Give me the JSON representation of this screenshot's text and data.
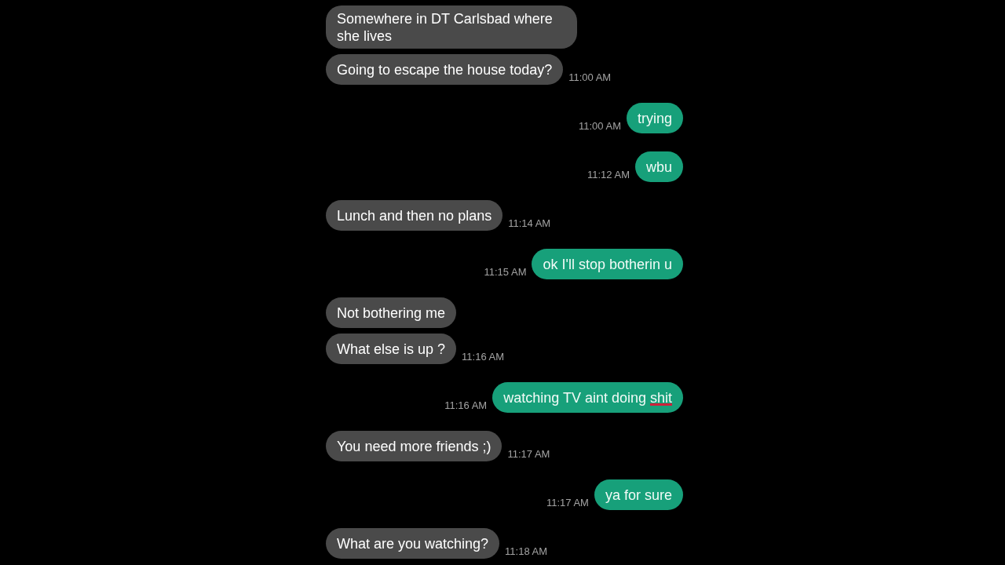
{
  "messages": [
    {
      "kind": "received",
      "text": "Somewhere in DT Carlsbad where she lives"
    },
    {
      "kind": "received",
      "text": "Going to escape the house today?",
      "time": "11:00 AM"
    },
    {
      "kind": "sent",
      "text": "trying",
      "time": "11:00 AM"
    },
    {
      "kind": "sent",
      "text": "wbu",
      "time": "11:12 AM"
    },
    {
      "kind": "received",
      "text": "Lunch and then no plans",
      "time": "11:14 AM"
    },
    {
      "kind": "sent",
      "text": "ok I'll stop botherin u",
      "time": "11:15 AM"
    },
    {
      "kind": "received",
      "text": "Not bothering me"
    },
    {
      "kind": "received",
      "text": "What else is up ?",
      "time": "11:16 AM"
    },
    {
      "kind": "sent",
      "text": "watching TV aint doing",
      "censored_text": "shit",
      "time": "11:16 AM"
    },
    {
      "kind": "received",
      "text": "You need more friends ;)",
      "time": "11:17 AM"
    },
    {
      "kind": "sent",
      "text": "ya for sure",
      "time": "11:17 AM"
    },
    {
      "kind": "received",
      "text": "What are you watching?",
      "time": "11:18 AM"
    }
  ]
}
